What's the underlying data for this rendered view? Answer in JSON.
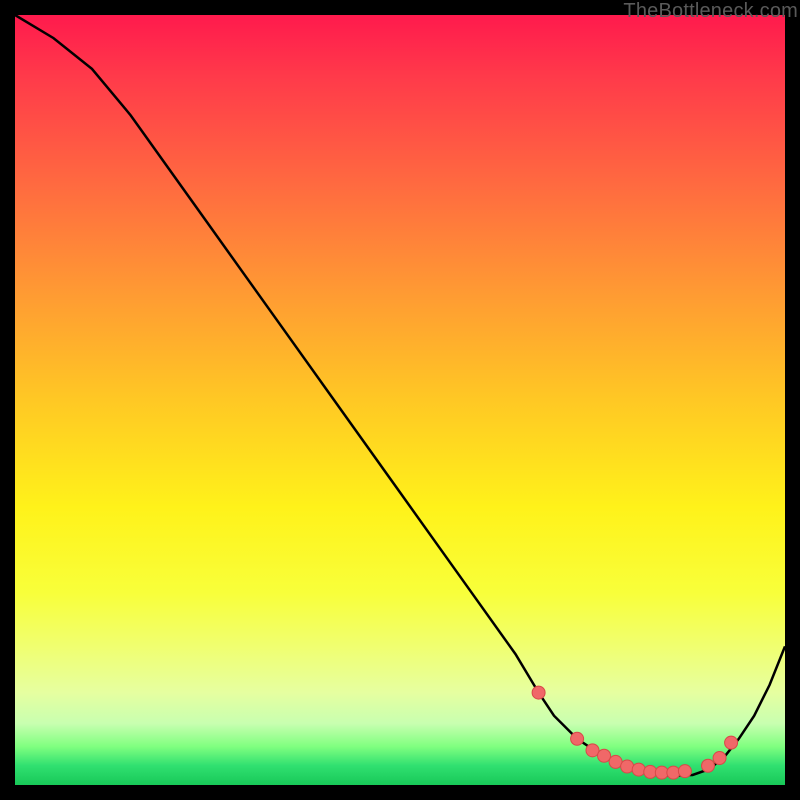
{
  "watermark": "TheBottleneck.com",
  "colors": {
    "curve": "#000000",
    "marker_fill": "#f06868",
    "marker_stroke": "#d84848"
  },
  "chart_data": {
    "type": "line",
    "title": "",
    "xlabel": "",
    "ylabel": "",
    "xlim": [
      0,
      100
    ],
    "ylim": [
      0,
      100
    ],
    "grid": false,
    "legend_position": "none",
    "series": [
      {
        "name": "bottleneck-curve",
        "x": [
          0,
          5,
          10,
          15,
          20,
          25,
          30,
          35,
          40,
          45,
          50,
          55,
          60,
          65,
          68,
          70,
          73,
          76,
          79,
          82,
          85,
          88,
          90,
          92,
          94,
          96,
          98,
          100
        ],
        "y": [
          100,
          97,
          93,
          87,
          80,
          73,
          66,
          59,
          52,
          45,
          38,
          31,
          24,
          17,
          12,
          9,
          6,
          4,
          2.5,
          1.5,
          1.2,
          1.3,
          2,
          3.5,
          6,
          9,
          13,
          18
        ]
      }
    ],
    "markers": {
      "name": "highlight-points",
      "x": [
        68,
        73,
        75,
        76.5,
        78,
        79.5,
        81,
        82.5,
        84,
        85.5,
        87,
        90,
        91.5,
        93
      ],
      "y": [
        12,
        6,
        4.5,
        3.8,
        3.0,
        2.4,
        2.0,
        1.7,
        1.6,
        1.6,
        1.8,
        2.5,
        3.5,
        5.5
      ]
    }
  }
}
